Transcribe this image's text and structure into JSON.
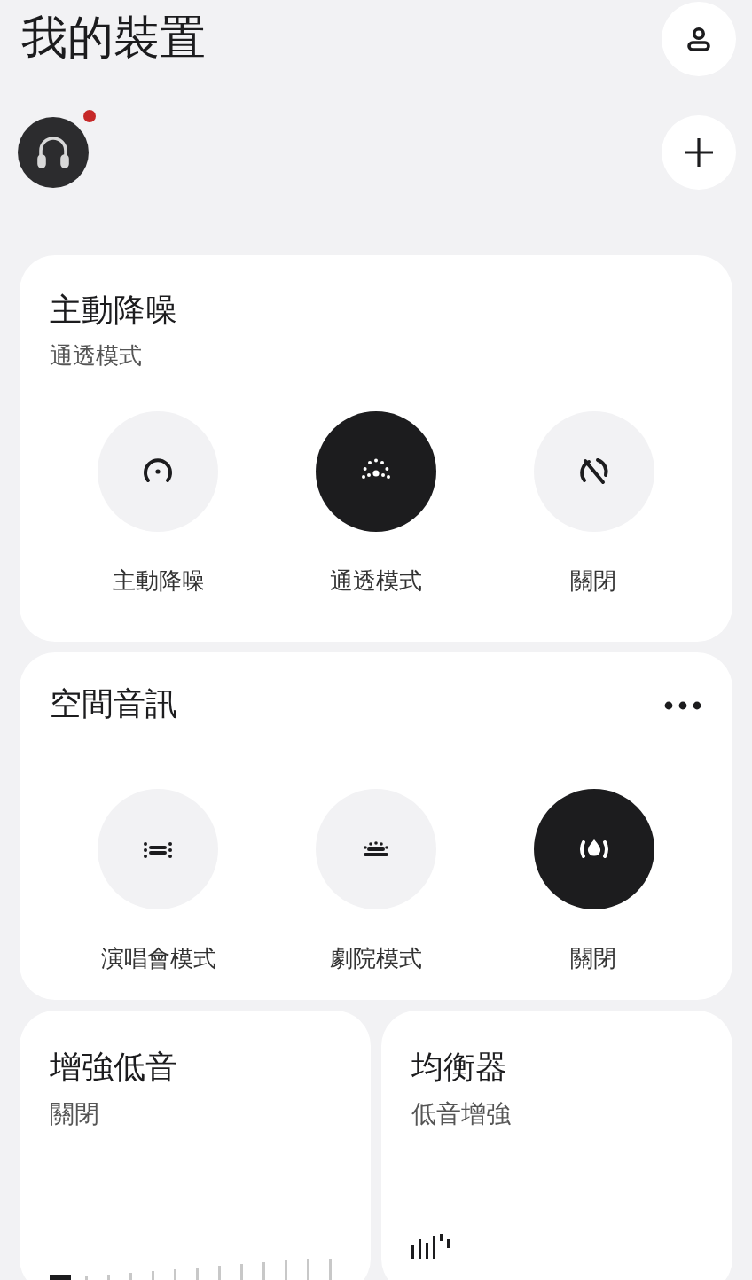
{
  "header": {
    "title": "我的裝置"
  },
  "device": {
    "has_notification": true
  },
  "noise_control": {
    "title": "主動降噪",
    "status": "通透模式",
    "modes": [
      {
        "kind": "anc",
        "label": "主動降噪",
        "selected": false
      },
      {
        "kind": "transparency",
        "label": "通透模式",
        "selected": true
      },
      {
        "kind": "off",
        "label": "關閉",
        "selected": false
      }
    ]
  },
  "spatial_audio": {
    "title": "空間音訊",
    "modes": [
      {
        "kind": "concert",
        "label": "演唱會模式",
        "selected": false
      },
      {
        "kind": "theater",
        "label": "劇院模式",
        "selected": false
      },
      {
        "kind": "spatial_off",
        "label": "關閉",
        "selected": true
      }
    ]
  },
  "bass_boost": {
    "title": "增強低音",
    "status": "關閉",
    "level": 0
  },
  "equalizer": {
    "title": "均衡器",
    "status": "低音增強"
  }
}
